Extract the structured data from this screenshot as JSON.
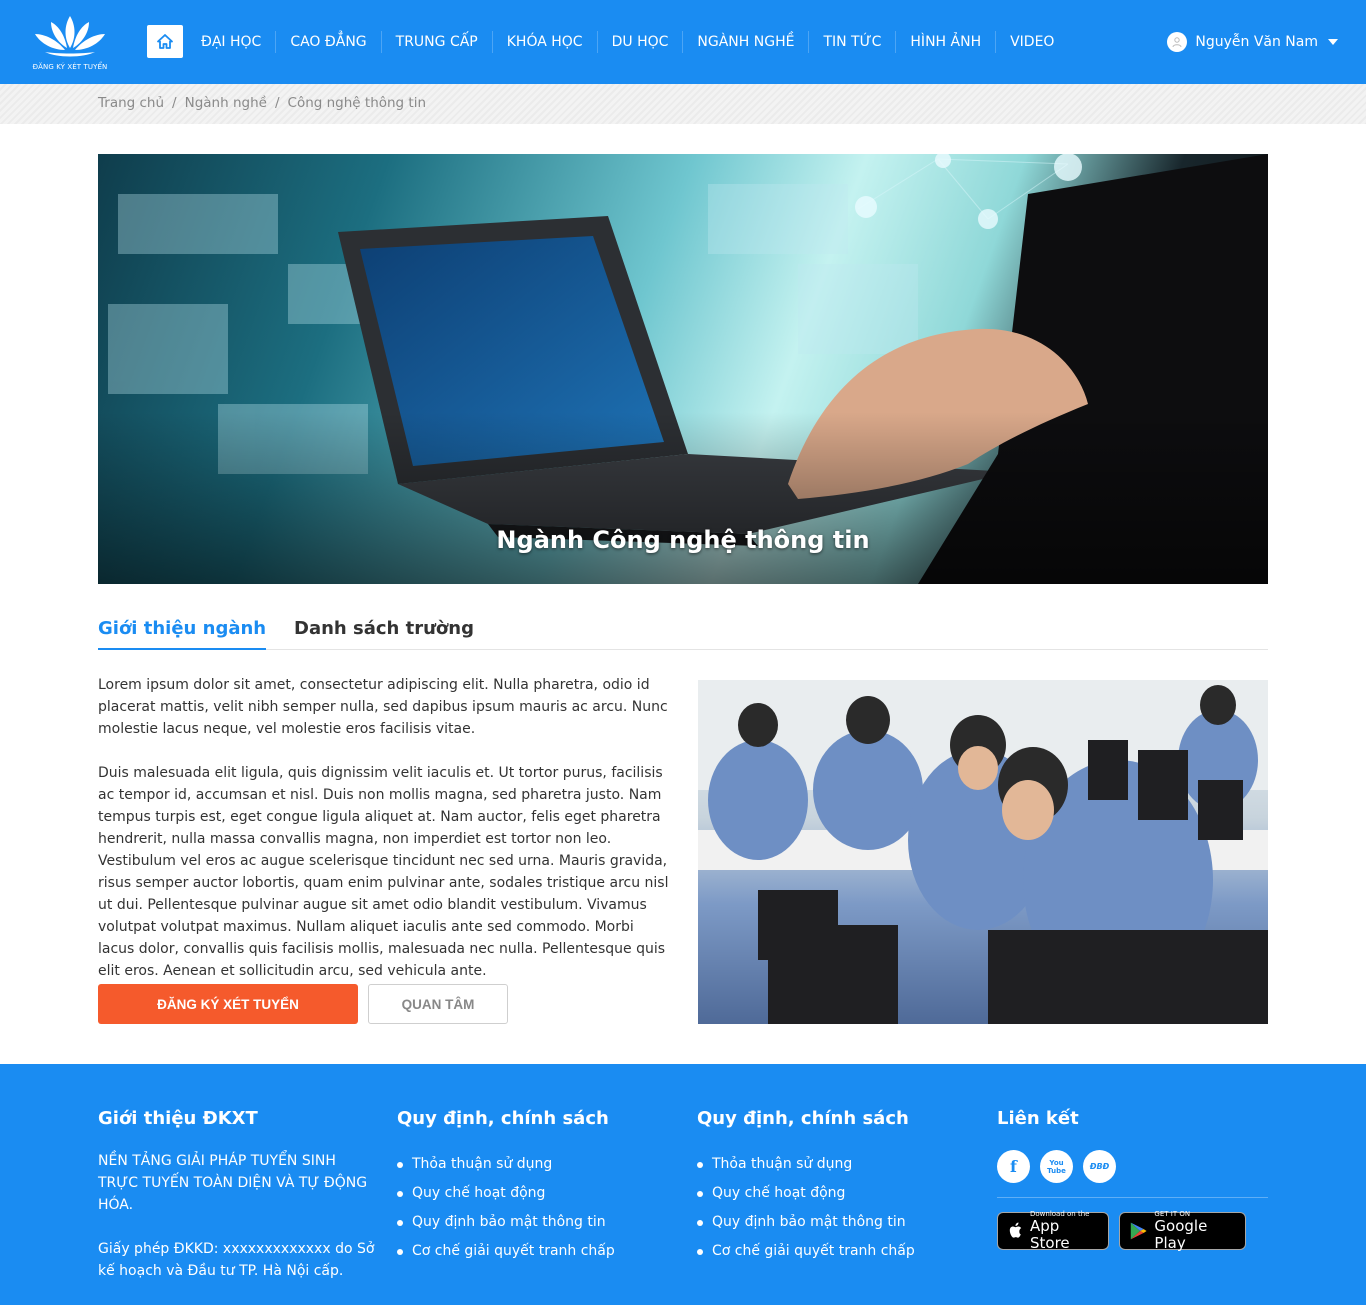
{
  "header": {
    "logo_text": "ĐĂNG KÝ XÉT TUYỂN",
    "nav": [
      "ĐẠI HỌC",
      "CAO ĐẲNG",
      "TRUNG CẤP",
      "KHÓA HỌC",
      "DU HỌC",
      "NGÀNH NGHỀ",
      "TIN TỨC",
      "HÌNH ẢNH",
      "VIDEO"
    ],
    "user_name": "Nguyễn Văn Nam"
  },
  "breadcrumb": [
    "Trang chủ",
    "Ngành nghề",
    "Công nghệ thông tin"
  ],
  "hero": {
    "title": "Ngành Công nghệ thông tin"
  },
  "tabs": [
    "Giới thiệu ngành",
    "Danh sách trường"
  ],
  "content": {
    "paragraphs": [
      "Lorem ipsum dolor sit amet, consectetur adipiscing elit. Nulla pharetra, odio id placerat mattis, velit nibh semper nulla, sed dapibus ipsum mauris ac arcu. Nunc molestie lacus neque, vel molestie eros facilisis vitae.",
      "Duis malesuada elit ligula, quis dignissim velit iaculis et. Ut tortor purus, facilisis ac tempor id, accumsan et nisl. Duis non mollis magna, sed pharetra justo. Nam tempus turpis est, eget congue ligula aliquet at. Nam auctor, felis eget pharetra hendrerit, nulla massa convallis magna, non imperdiet est tortor non leo. Vestibulum vel eros ac augue scelerisque tincidunt nec sed urna. Mauris gravida, risus semper auctor lobortis, quam enim pulvinar ante, sodales tristique arcu nisl ut dui. Pellentesque pulvinar augue sit amet odio blandit vestibulum. Vivamus volutpat volutpat maximus. Nullam aliquet iaculis ante sed commodo. Morbi lacus dolor, convallis quis facilisis mollis, malesuada nec nulla. Pellentesque quis elit eros. Aenean et sollicitudin arcu, sed vehicula ante."
    ],
    "register_button": "ĐĂNG KÝ XÉT TUYỂN",
    "interest_button": "QUAN TÂM"
  },
  "footer": {
    "col1": {
      "title": "Giới thiệu ĐKXT",
      "text1": "NỀN TẢNG GIẢI PHÁP TUYỂN SINH TRỰC TUYẾN TOÀN DIỆN VÀ TỰ ĐỘNG HÓA.",
      "text2": "Giấy phép ĐKKD: xxxxxxxxxxxxx do Sở kế hoạch và Đầu tư TP. Hà Nội cấp."
    },
    "col2": {
      "title": "Quy định, chính sách",
      "links": [
        "Thỏa thuận sử dụng",
        "Quy chế hoạt động",
        "Quy định bảo mật thông tin",
        "Cơ chế giải quyết tranh chấp"
      ]
    },
    "col3": {
      "title": "Quy định, chính sách",
      "links": [
        "Thỏa thuận sử dụng",
        "Quy chế hoạt động",
        "Quy định bảo mật thông tin",
        "Cơ chế giải quyết tranh chấp"
      ]
    },
    "col4": {
      "title": "Liên kết",
      "social": [
        "f",
        "You Tube",
        "ĐBĐ"
      ],
      "app_store_small": "Download on the",
      "app_store_big": "App Store",
      "google_play_small": "GET IT ON",
      "google_play_big": "Google Play"
    }
  },
  "colors": {
    "primary": "#1a8cf2",
    "accent": "#f55a2c"
  }
}
